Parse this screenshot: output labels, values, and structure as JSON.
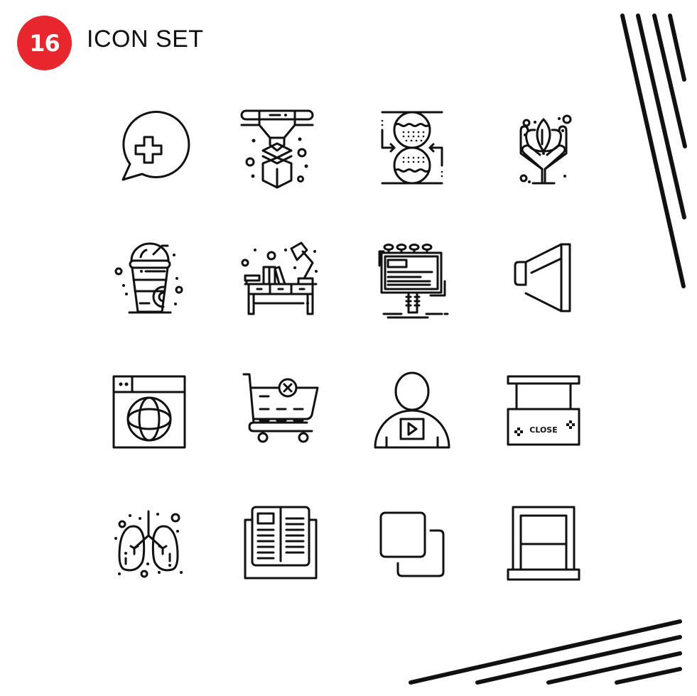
{
  "header": {
    "badge_number": "16",
    "title": "ICON SET",
    "badge_color": "#e8262d"
  },
  "icons": [
    {
      "name": "chat-add",
      "row": 1,
      "col": 1
    },
    {
      "name": "3d-printer",
      "row": 1,
      "col": 2
    },
    {
      "name": "rollers-exchange",
      "row": 1,
      "col": 3
    },
    {
      "name": "hands-lotus",
      "row": 1,
      "col": 4
    },
    {
      "name": "frappe-cup",
      "row": 2,
      "col": 1
    },
    {
      "name": "desk-lamp-books",
      "row": 2,
      "col": 2
    },
    {
      "name": "billboard",
      "row": 2,
      "col": 3
    },
    {
      "name": "megaphone-horn",
      "row": 2,
      "col": 4
    },
    {
      "name": "browser-globe",
      "row": 3,
      "col": 1
    },
    {
      "name": "cart-remove",
      "row": 3,
      "col": 2
    },
    {
      "name": "user-video",
      "row": 3,
      "col": 3
    },
    {
      "name": "close-sign",
      "row": 3,
      "col": 4
    },
    {
      "name": "lungs",
      "row": 4,
      "col": 1
    },
    {
      "name": "open-book",
      "row": 4,
      "col": 2
    },
    {
      "name": "copy-squares",
      "row": 4,
      "col": 3
    },
    {
      "name": "window",
      "row": 4,
      "col": 4
    }
  ],
  "close_sign": {
    "label": "CLOSE"
  }
}
